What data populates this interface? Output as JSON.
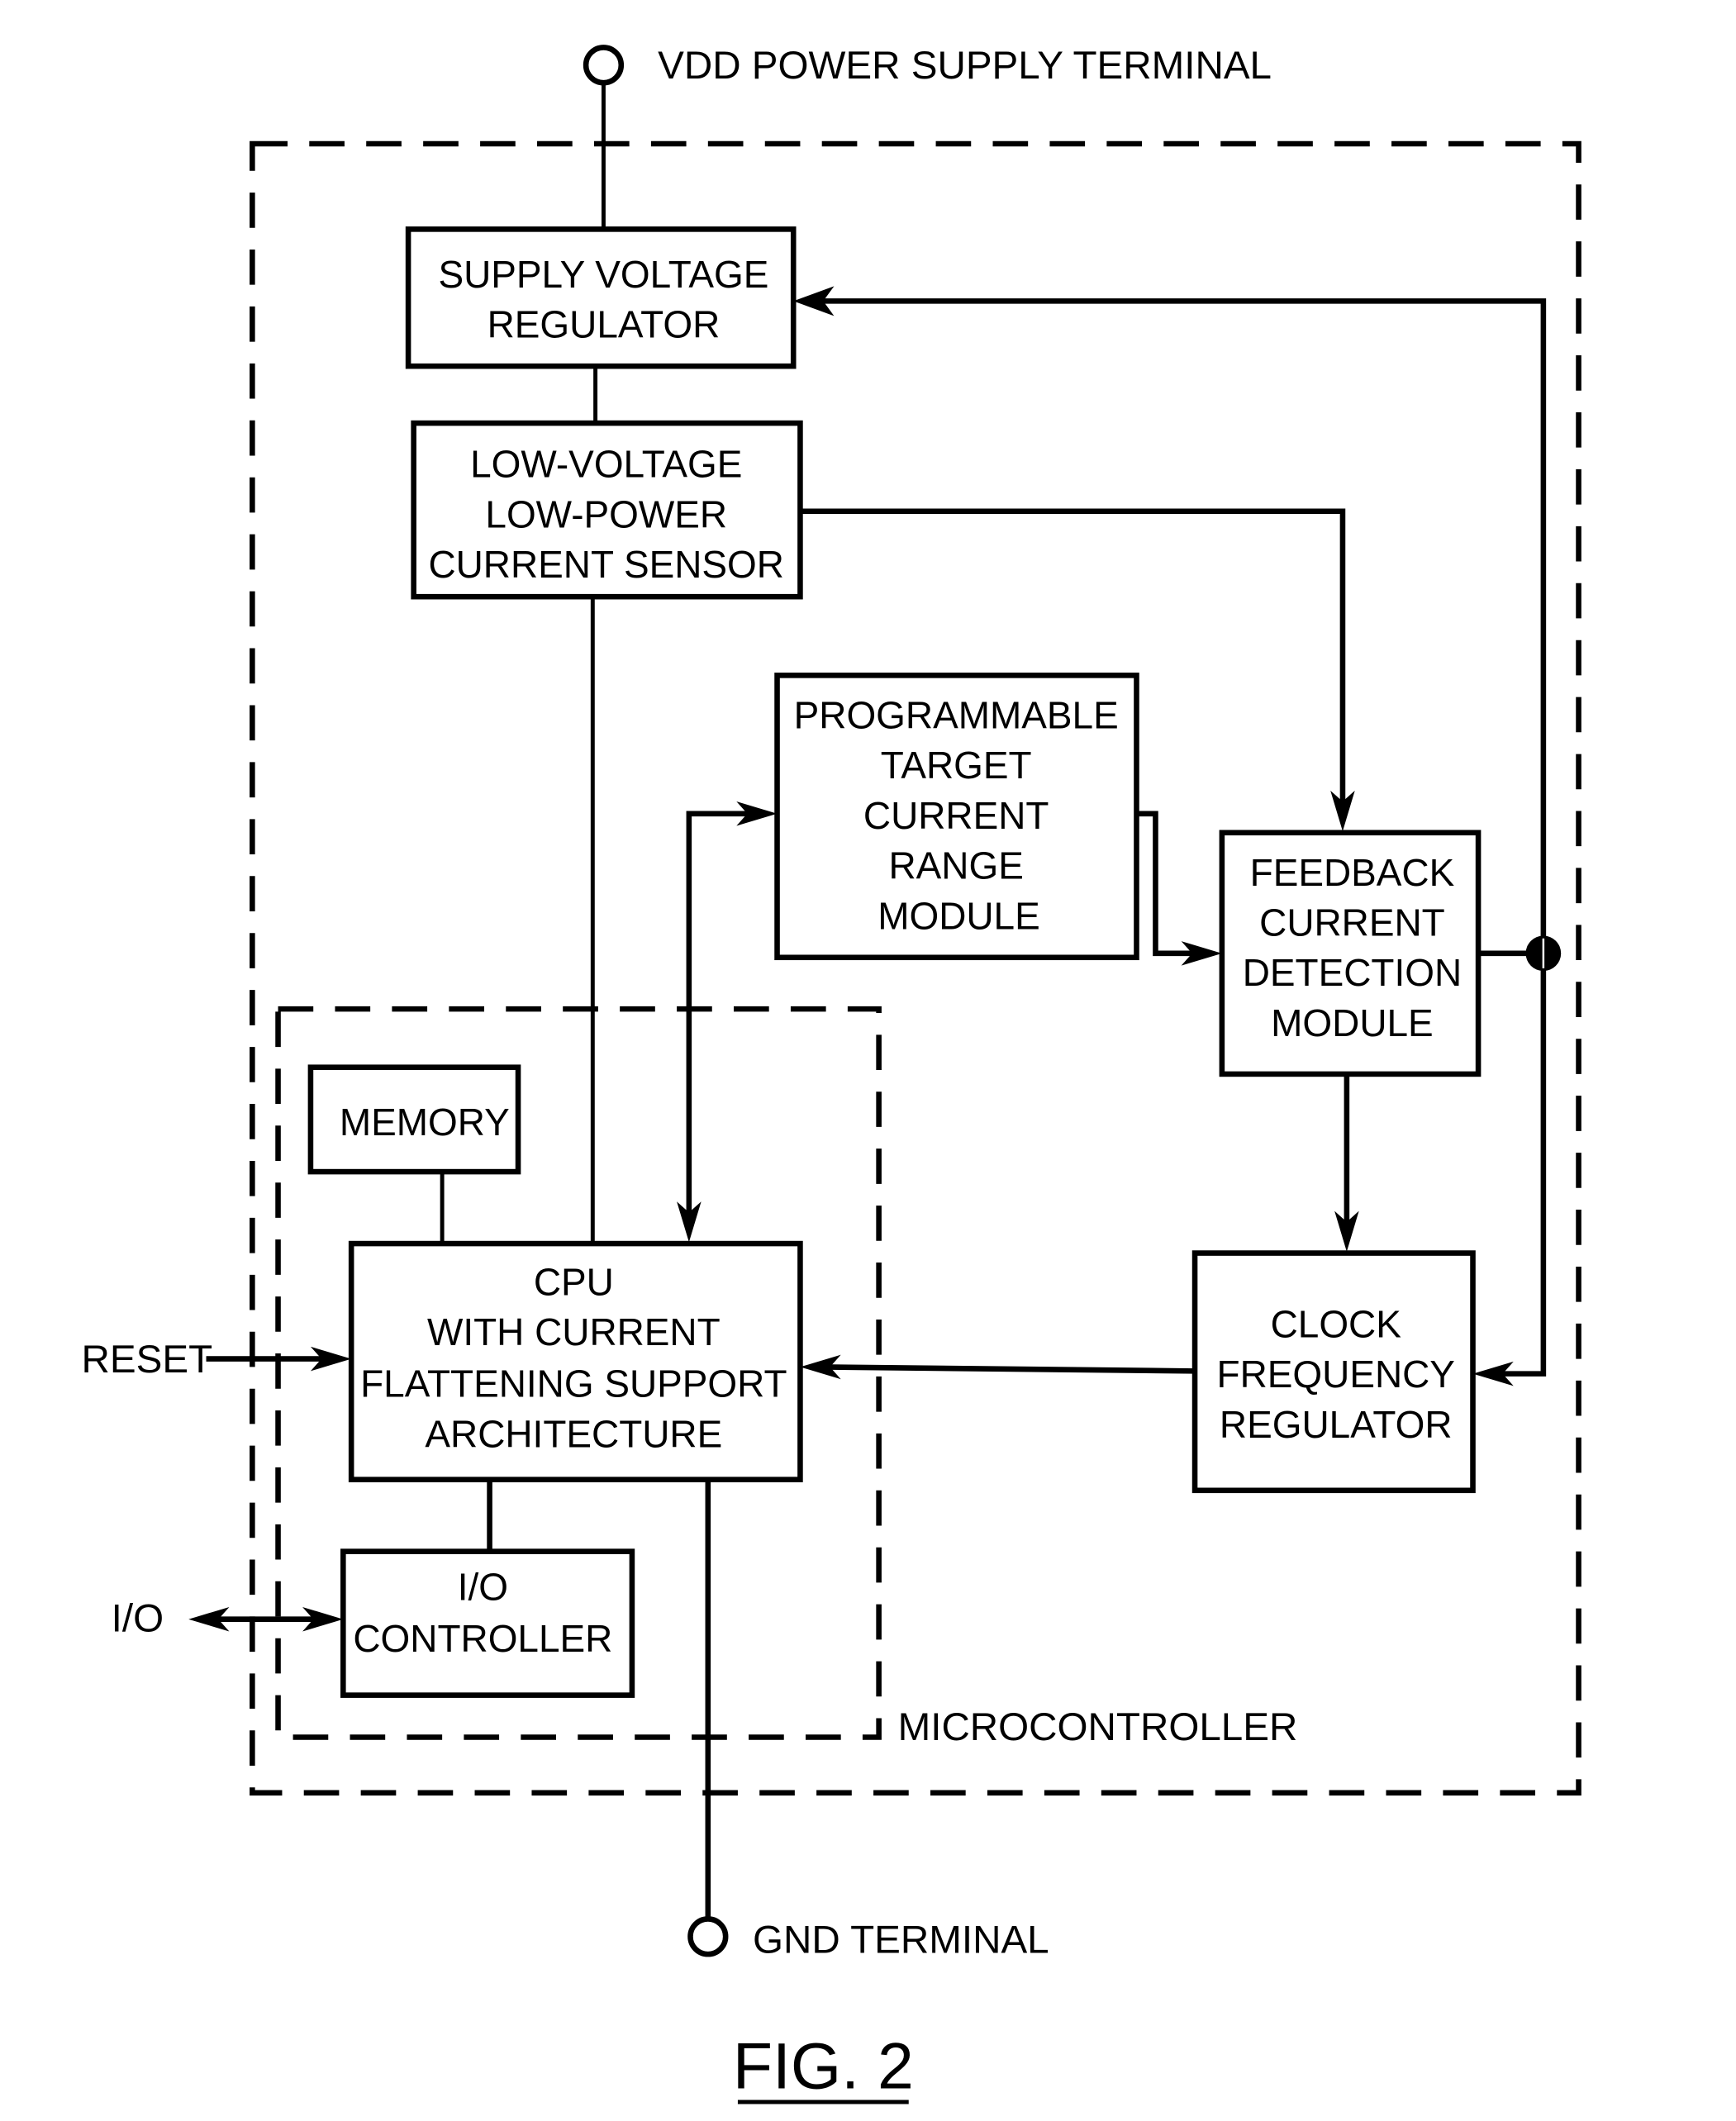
{
  "figure": {
    "caption": "FIG. 2",
    "terminals": {
      "vdd": "VDD POWER SUPPLY TERMINAL",
      "gnd": "GND TERMINAL"
    },
    "outer_boundary_label": "MICROCONTROLLER",
    "external_signals": {
      "reset": "RESET",
      "io": "I/O"
    },
    "blocks": {
      "supply_voltage_regulator": [
        "SUPPLY VOLTAGE",
        "REGULATOR"
      ],
      "current_sensor": [
        "LOW-VOLTAGE",
        "LOW-POWER",
        "CURRENT SENSOR"
      ],
      "target_current_range": [
        "PROGRAMMABLE",
        "TARGET",
        "CURRENT",
        "RANGE",
        "MODULE"
      ],
      "feedback_detection": [
        "FEEDBACK",
        "CURRENT",
        "DETECTION",
        "MODULE"
      ],
      "memory": [
        "MEMORY"
      ],
      "cpu": [
        "CPU",
        "WITH CURRENT",
        "FLATTENING SUPPORT",
        "ARCHITECTURE"
      ],
      "io_controller": [
        "I/O",
        "CONTROLLER"
      ],
      "clock_frequency_regulator": [
        "CLOCK",
        "FREQUENCY",
        "REGULATOR"
      ]
    }
  }
}
